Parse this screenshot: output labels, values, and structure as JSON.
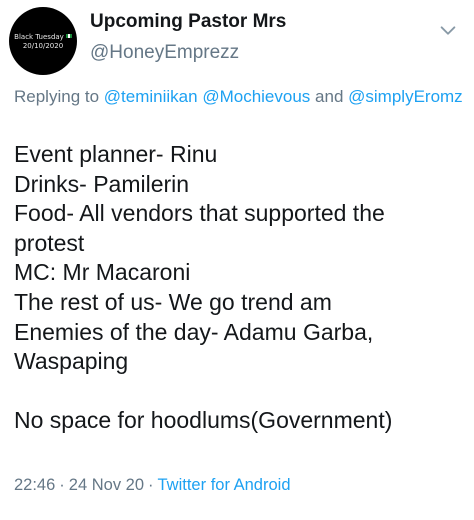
{
  "author": {
    "display_name": "Upcoming Pastor Mrs",
    "handle": "@HoneyEmprezz",
    "avatar_text_line1": "Black Tuesday",
    "avatar_text_line2": "20/10/2020"
  },
  "reply": {
    "prefix": "Replying to",
    "mentions": [
      "@teminiikan",
      "@Mochievous"
    ],
    "conjunction": "and",
    "last_mention": "@simplyEromz"
  },
  "body": {
    "lines": [
      "Event planner- Rinu",
      "Drinks- Pamilerin",
      "Food- All vendors that supported the",
      "protest",
      "MC: Mr Macaroni",
      "The rest of us- We go trend am",
      "Enemies of the day- Adamu Garba,",
      "Waspaping",
      "",
      "No space for hoodlums(Government)"
    ]
  },
  "meta": {
    "time": "22:46",
    "separator": "·",
    "date": "24 Nov 20",
    "source": "Twitter for Android"
  },
  "icons": {
    "more": "chevron-down-icon",
    "flag": "nigeria-flag-icon"
  },
  "colors": {
    "text": "#14171a",
    "secondary": "#657786",
    "link": "#1da1f2",
    "avatar_bg": "#000000"
  }
}
